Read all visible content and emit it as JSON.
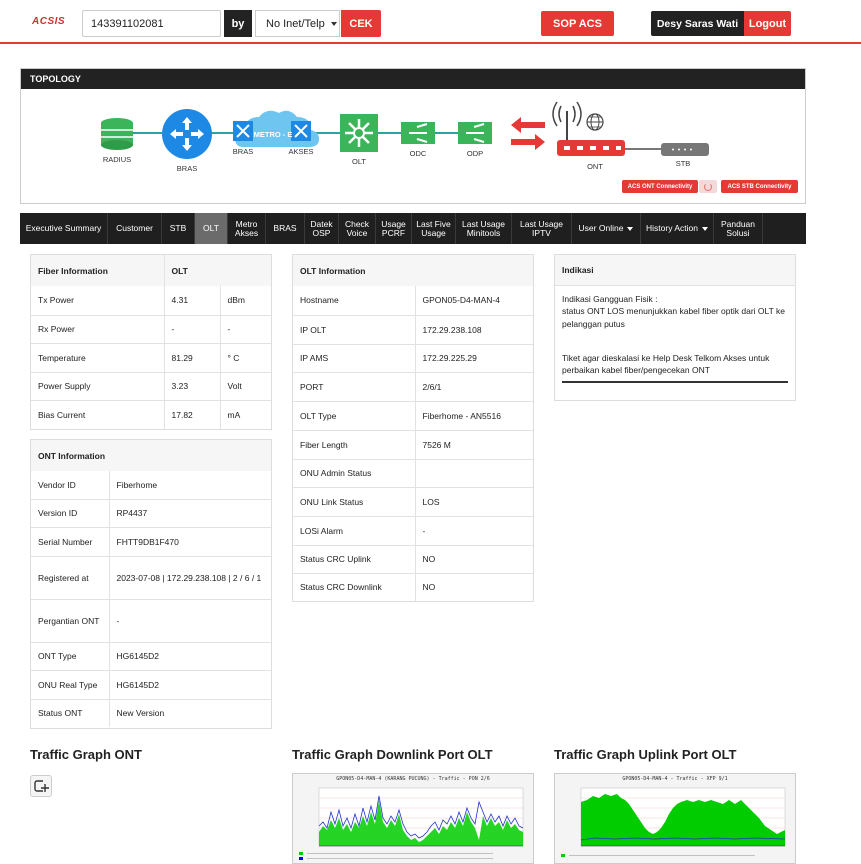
{
  "header": {
    "logo": "ACSIS",
    "search_value": "143391102081",
    "by_label": "by",
    "select_value": "No Inet/Telp",
    "cek_label": "CEK",
    "sop_label": "SOP ACS",
    "user_name": "Desy Saras Wati",
    "logout_label": "Logout"
  },
  "topology": {
    "title": "TOPOLOGY",
    "nodes": {
      "radius": "RADIUS",
      "bras": "BRAS",
      "bras2": "BRAS",
      "metro": "METRO - E",
      "akses": "AKSES",
      "olt": "OLT",
      "odc": "ODC",
      "odp": "ODP",
      "ont": "ONT",
      "stb": "STB"
    },
    "acs_ont_btn": "ACS ONT Connectivity",
    "acs_stb_btn": "ACS STB Connectivity"
  },
  "tabs": [
    {
      "l1": "Executive Summary",
      "l2": ""
    },
    {
      "l1": "Customer",
      "l2": ""
    },
    {
      "l1": "STB",
      "l2": ""
    },
    {
      "l1": "OLT",
      "l2": ""
    },
    {
      "l1": "Metro",
      "l2": "Akses"
    },
    {
      "l1": "BRAS",
      "l2": ""
    },
    {
      "l1": "Datek",
      "l2": "OSP"
    },
    {
      "l1": "Check",
      "l2": "Voice"
    },
    {
      "l1": "Usage",
      "l2": "PCRF"
    },
    {
      "l1": "Last Five",
      "l2": "Usage"
    },
    {
      "l1": "Last Usage",
      "l2": "Minitools"
    },
    {
      "l1": "Last Usage",
      "l2": "IPTV"
    },
    {
      "l1": "User Online",
      "l2": ""
    },
    {
      "l1": "History Action",
      "l2": ""
    },
    {
      "l1": "Panduan",
      "l2": "Solusi"
    }
  ],
  "fiber": {
    "head": [
      "Fiber Information",
      "OLT"
    ],
    "rows": [
      [
        "Tx Power",
        "4.31",
        "dBm"
      ],
      [
        "Rx Power",
        "-",
        "-"
      ],
      [
        "Temperature",
        "81.29",
        "° C"
      ],
      [
        "Power Supply",
        "3.23",
        "Volt"
      ],
      [
        "Bias Current",
        "17.82",
        "mA"
      ]
    ]
  },
  "ont": {
    "head": "ONT Information",
    "rows": [
      [
        "Vendor ID",
        "Fiberhome"
      ],
      [
        "Version ID",
        "RP4437"
      ],
      [
        "Serial Number",
        "FHTT9DB1F470"
      ],
      [
        "Registered at",
        "2023-07-08 | 172.29.238.108 | 2 / 6 / 1"
      ],
      [
        "Pergantian ONT",
        "-"
      ],
      [
        "ONT Type",
        "HG6145D2"
      ],
      [
        "ONU Real Type",
        "HG6145D2"
      ],
      [
        "Status ONT",
        "New Version"
      ]
    ]
  },
  "olt": {
    "head": "OLT Information",
    "rows": [
      [
        "Hostname",
        "GPON05-D4-MAN-4"
      ],
      [
        "IP OLT",
        "172.29.238.108"
      ],
      [
        "IP AMS",
        "172.29.225.29"
      ],
      [
        "PORT",
        "2/6/1"
      ],
      [
        "OLT Type",
        "Fiberhome - AN5516"
      ],
      [
        "Fiber Length",
        "7526 M"
      ],
      [
        "ONU Admin Status",
        ""
      ],
      [
        "ONU Link Status",
        "LOS"
      ],
      [
        "LOSi Alarm",
        "-"
      ],
      [
        "Status CRC Uplink",
        "NO"
      ],
      [
        "Status CRC Downlink",
        "NO"
      ]
    ]
  },
  "indikasi": {
    "head": "Indikasi",
    "line1": "Indikasi Gangguan Fisik :",
    "line2": "status ONT LOS menunjukkan kabel fiber optik dari OLT ke pelanggan putus",
    "line3": "Tiket agar dieskalasi ke Help Desk Telkom Akses untuk perbaikan kabel fiber/pengecekan ONT"
  },
  "graphs": {
    "ont_title": "Traffic Graph ONT",
    "downlink_title": "Traffic Graph Downlink Port OLT",
    "uplink_title": "Traffic Graph Uplink Port OLT",
    "downlink_caption": "GPON05-D4-MAN-4 (KARANG PUCUNG) - Traffic - PON 2/6",
    "uplink_caption": "GPON05-D4-MAN-4 - Traffic - XFP 9/1",
    "colors": {
      "inbound": "#00cc00",
      "outbound": "#0000ff"
    }
  }
}
